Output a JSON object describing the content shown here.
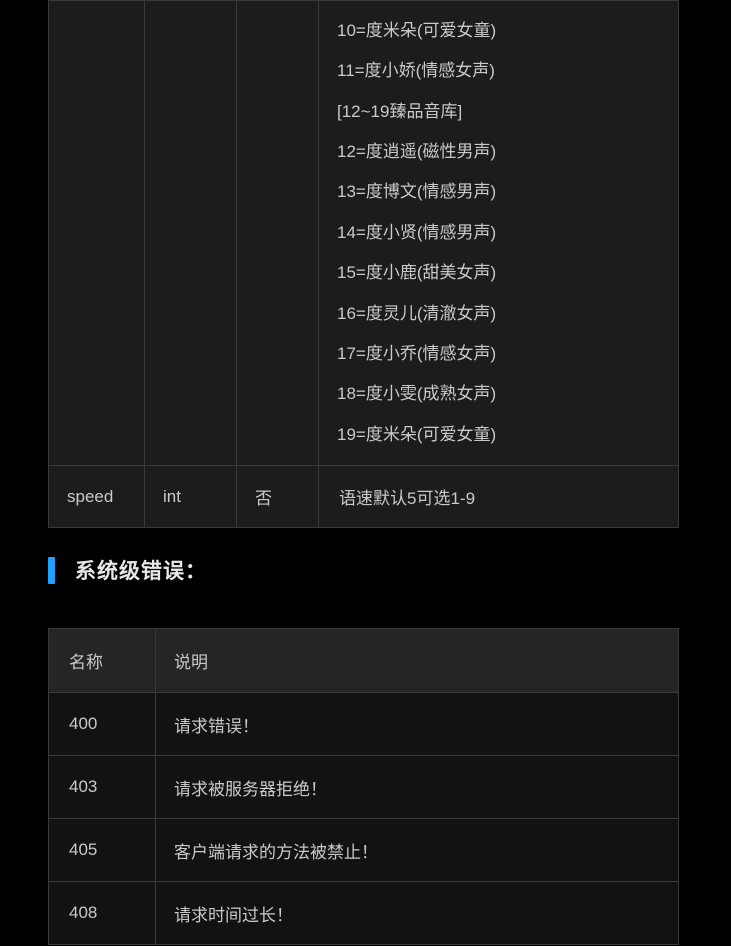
{
  "colors": {
    "page_background": "#000000",
    "table_border": "#3a3a3a",
    "text": "#c9c9c9",
    "heading_accent": "#1ea0ff",
    "header_row_background": "#252525",
    "body_row_background": "#121212"
  },
  "params_table": {
    "voice_options": [
      "10=度米朵(可爱女童)",
      "11=度小娇(情感女声)",
      "[12~19臻品音库]",
      "12=度逍遥(磁性男声)",
      "13=度博文(情感男声)",
      "14=度小贤(情感男声)",
      "15=度小鹿(甜美女声)",
      "16=度灵儿(清澈女声)",
      "17=度小乔(情感女声)",
      "18=度小雯(成熟女声)",
      "19=度米朵(可爱女童)"
    ],
    "speed_row": {
      "name": "speed",
      "type": "int",
      "required": "否",
      "description": "语速默认5可选1-9"
    }
  },
  "section": {
    "heading": "系统级错误："
  },
  "error_table": {
    "headers": {
      "name": "名称",
      "description": "说明"
    },
    "rows": [
      {
        "code": "400",
        "description": "请求错误！"
      },
      {
        "code": "403",
        "description": "请求被服务器拒绝！"
      },
      {
        "code": "405",
        "description": "客户端请求的方法被禁止！"
      },
      {
        "code": "408",
        "description": "请求时间过长！"
      }
    ]
  }
}
